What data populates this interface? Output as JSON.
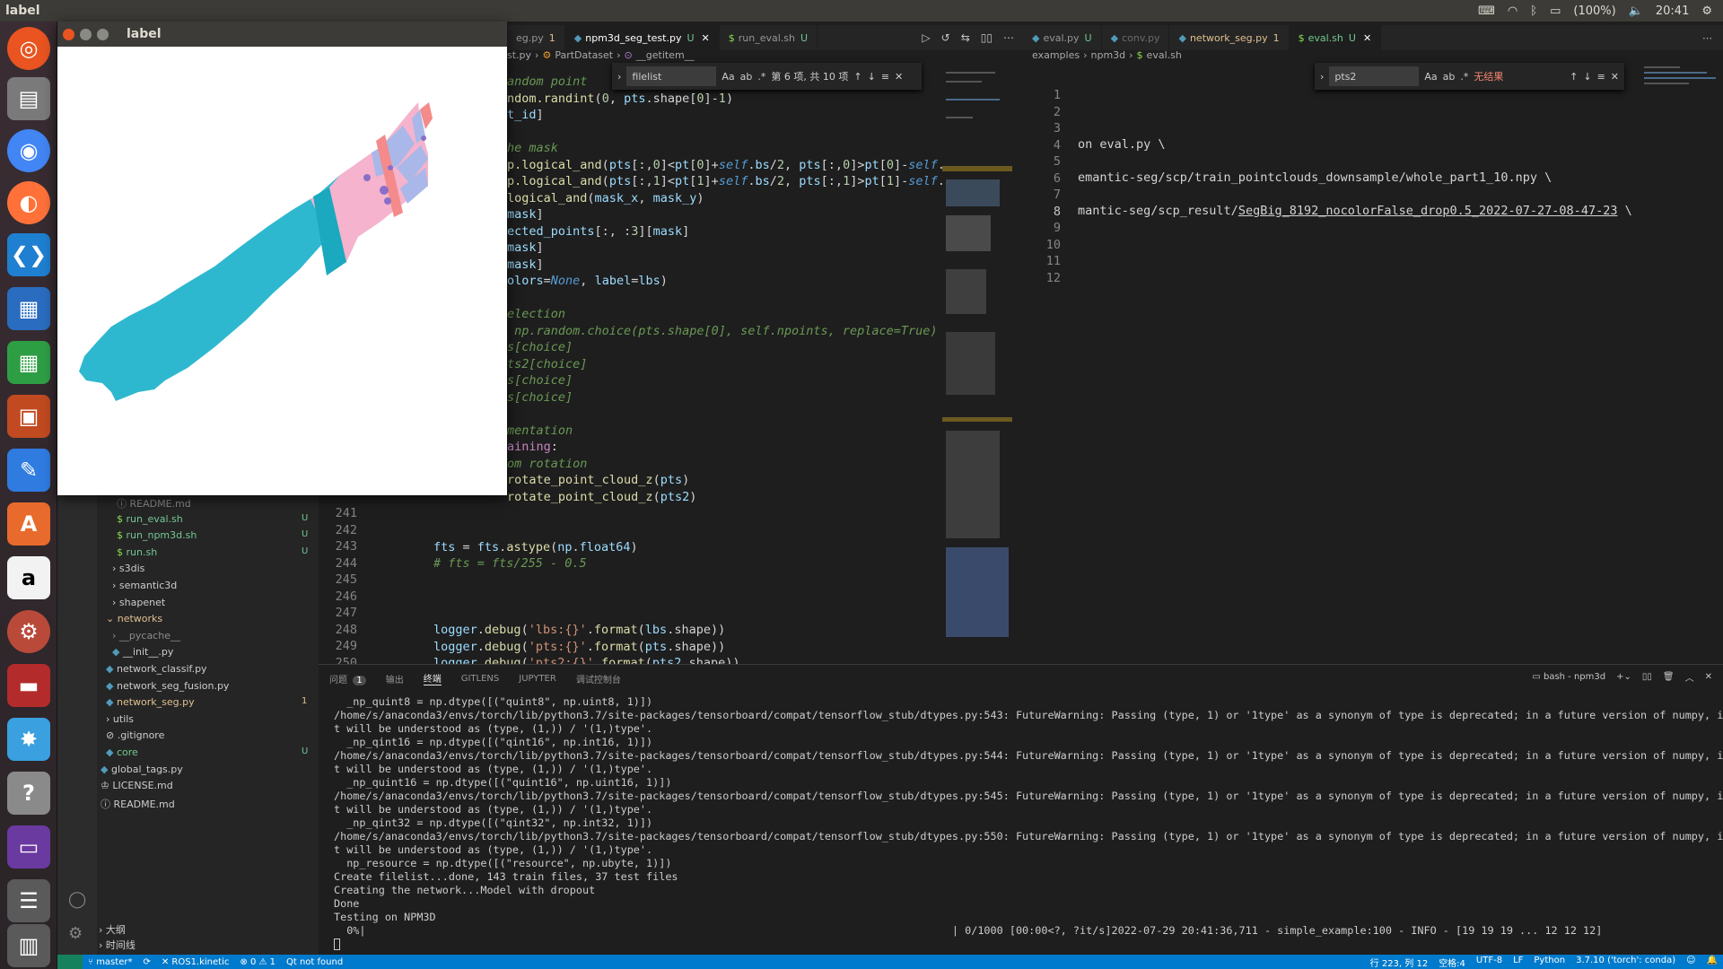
{
  "topbar": {
    "title": "label",
    "battery": "(100%)",
    "clock": "20:41"
  },
  "label_window": {
    "title": "label"
  },
  "editor_left": {
    "tabs": [
      {
        "label": "eg.py",
        "status": "1",
        "active": false
      },
      {
        "label": "npm3d_seg_test.py",
        "status": "U",
        "active": true
      },
      {
        "label": "run_eval.sh",
        "status": "U",
        "active": false
      }
    ],
    "breadcrumb": [
      "st.py",
      "PartDataset",
      "__getitem__"
    ],
    "find": {
      "query": "filelist",
      "result": "第 6 项, 共 10 项"
    },
    "line_numbers": [
      "241",
      "242",
      "243",
      "244",
      "245",
      "246",
      "247",
      "248",
      "249",
      "250"
    ]
  },
  "editor_right": {
    "tabs": [
      {
        "label": "eval.py",
        "status": "U",
        "active": false
      },
      {
        "label": "conv.py",
        "status": "",
        "active": false
      },
      {
        "label": "network_seg.py",
        "status": "1",
        "active": false
      },
      {
        "label": "eval.sh",
        "status": "U",
        "active": true
      }
    ],
    "breadcrumb": [
      "examples",
      "npm3d",
      "eval.sh"
    ],
    "find": {
      "query": "pts2",
      "result": "无结果"
    },
    "line_numbers": [
      "1",
      "2",
      "3",
      "4",
      "5",
      "6",
      "7",
      "8",
      "9",
      "10",
      "11",
      "12"
    ],
    "lines": {
      "l4": "on eval.py \\",
      "l6": "emantic-seg/scp/train_pointclouds_downsample/whole_part1_10.npy \\",
      "l8_prefix": "mantic-seg/scp_result/",
      "l8_link": "SegBig_8192_nocolorFalse_drop0.5_2022-07-27-08-47-23",
      "l8_suffix": " \\"
    }
  },
  "explorer": {
    "items": [
      {
        "label": "README.md",
        "cls": "dim"
      },
      {
        "label": "run_eval.sh",
        "cls": "green",
        "badge": "U"
      },
      {
        "label": "run_npm3d.sh",
        "cls": "green",
        "badge": "U"
      },
      {
        "label": "run.sh",
        "cls": "green",
        "badge": "U"
      },
      {
        "label": "s3dis",
        "cls": ""
      },
      {
        "label": "semantic3d",
        "cls": ""
      },
      {
        "label": "shapenet",
        "cls": ""
      },
      {
        "label": "networks",
        "cls": "orange"
      },
      {
        "label": "__pycache__",
        "cls": "dim"
      },
      {
        "label": "__init__.py",
        "cls": ""
      },
      {
        "label": "network_classif.py",
        "cls": ""
      },
      {
        "label": "network_seg_fusion.py",
        "cls": ""
      },
      {
        "label": "network_seg.py",
        "cls": "orange",
        "badge": "1"
      },
      {
        "label": "utils",
        "cls": ""
      },
      {
        "label": ".gitignore",
        "cls": ""
      },
      {
        "label": "core",
        "cls": "green",
        "badge": "U"
      },
      {
        "label": "global_tags.py",
        "cls": ""
      },
      {
        "label": "LICENSE.md",
        "cls": ""
      },
      {
        "label": "README.md",
        "cls": ""
      }
    ],
    "outline": "大纲",
    "timeline": "时间线"
  },
  "panel": {
    "tabs": [
      "问题",
      "1",
      "输出",
      "终端",
      "GITLENS",
      "JUPYTER",
      "调试控制台"
    ],
    "shell": "bash - npm3d",
    "terminal_lines": [
      "  _np_quint8 = np.dtype([(\"quint8\", np.uint8, 1)])",
      "/home/s/anaconda3/envs/torch/lib/python3.7/site-packages/tensorboard/compat/tensorflow_stub/dtypes.py:543: FutureWarning: Passing (type, 1) or '1type' as a synonym of type is deprecated; in a future version of numpy, i",
      "t will be understood as (type, (1,)) / '(1,)type'.",
      "  _np_qint16 = np.dtype([(\"qint16\", np.int16, 1)])",
      "/home/s/anaconda3/envs/torch/lib/python3.7/site-packages/tensorboard/compat/tensorflow_stub/dtypes.py:544: FutureWarning: Passing (type, 1) or '1type' as a synonym of type is deprecated; in a future version of numpy, i",
      "t will be understood as (type, (1,)) / '(1,)type'.",
      "  _np_quint16 = np.dtype([(\"quint16\", np.uint16, 1)])",
      "/home/s/anaconda3/envs/torch/lib/python3.7/site-packages/tensorboard/compat/tensorflow_stub/dtypes.py:545: FutureWarning: Passing (type, 1) or '1type' as a synonym of type is deprecated; in a future version of numpy, i",
      "t will be understood as (type, (1,)) / '(1,)type'.",
      "  _np_qint32 = np.dtype([(\"qint32\", np.int32, 1)])",
      "/home/s/anaconda3/envs/torch/lib/python3.7/site-packages/tensorboard/compat/tensorflow_stub/dtypes.py:550: FutureWarning: Passing (type, 1) or '1type' as a synonym of type is deprecated; in a future version of numpy, i",
      "t will be understood as (type, (1,)) / '(1,)type'.",
      "  np_resource = np.dtype([(\"resource\", np.ubyte, 1)])",
      "Create filelist...done, 143 train files, 37 test files",
      "Creating the network...Model with dropout",
      "Done",
      "Testing on NPM3D",
      "  0%|                                                                                            | 0/1000 [00:00<?, ?it/s]2022-07-29 20:41:36,711 - simple_example:100 - INFO - [19 19 19 ... 12 12 12]"
    ]
  },
  "statusbar": {
    "branch": "master*",
    "ros": "ROS1.kinetic",
    "problems": "0 ⚠ 1",
    "qt": "Qt not found",
    "position": "行 223, 列 12",
    "spaces": "空格:4",
    "encoding": "UTF-8",
    "eol": "LF",
    "language": "Python",
    "interpreter": "3.7.10 ('torch': conda)"
  },
  "colors": {
    "accent": "#007acc",
    "cyan_segment": "#2eb8cf",
    "pink_segment": "#f5b3cd",
    "lilac_segment": "#a9b8e8",
    "salmon_segment": "#f48a8a",
    "purple_segment": "#8a6fc8"
  }
}
